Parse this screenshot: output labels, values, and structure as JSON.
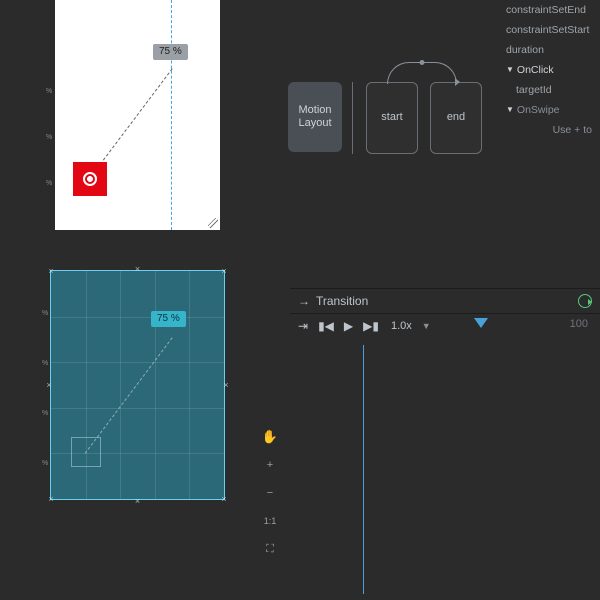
{
  "previews": {
    "top": {
      "badge": "75 %",
      "guide_x_pct": 70
    },
    "bottom": {
      "badge": "75 %"
    }
  },
  "scene": {
    "motion_layout_label": "Motion\nLayout",
    "start_label": "start",
    "end_label": "end"
  },
  "properties": {
    "constraintSetEnd": "constraintSetEnd",
    "constraintSetStart": "constraintSetStart",
    "duration": "duration",
    "onClick": "OnClick",
    "targetId": "targetId",
    "onSwipe": "OnSwipe",
    "use_plus": "Use + to"
  },
  "timeline": {
    "title": "Transition",
    "speed": "1.0x",
    "end_frame": "100",
    "playhead_pct": 22
  },
  "tools": {
    "hand": "✋",
    "zoom_in": "+",
    "zoom_out": "−",
    "one_to_one": "1:1",
    "fit": "⛶"
  }
}
